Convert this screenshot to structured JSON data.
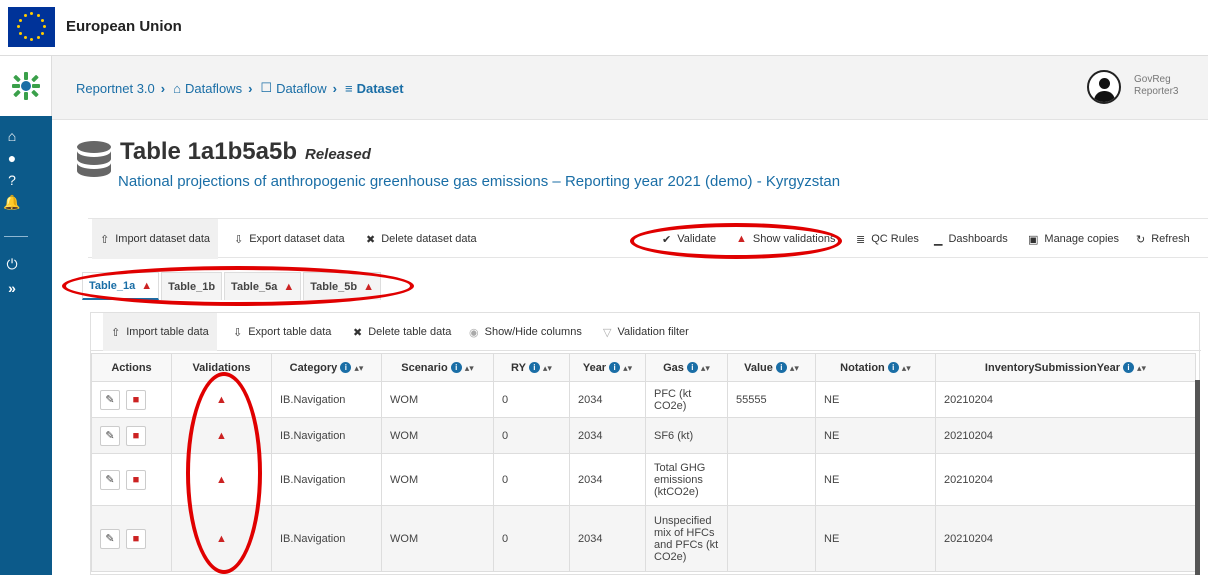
{
  "eu": {
    "title": "European Union"
  },
  "breadcrumb": {
    "items": [
      "Reportnet 3.0",
      "Dataflows",
      "Dataflow",
      "Dataset"
    ]
  },
  "user": {
    "line1": "GovReg",
    "line2": "Reporter3"
  },
  "page": {
    "title": "Table 1a1b5a5b",
    "status": "Released",
    "subtitle": "National projections of anthropogenic greenhouse gas emissions – Reporting year 2021 (demo) - Kyrgyzstan"
  },
  "dataset_toolbar": {
    "import": "Import dataset data",
    "export": "Export dataset data",
    "delete": "Delete dataset data",
    "validate": "Validate",
    "show_validations": "Show validations",
    "qc_rules": "QC Rules",
    "dashboards": "Dashboards",
    "manage_copies": "Manage copies",
    "refresh": "Refresh"
  },
  "tabs": [
    {
      "label": "Table_1a",
      "has_error": true
    },
    {
      "label": "Table_1b",
      "has_error": false
    },
    {
      "label": "Table_5a",
      "has_error": true
    },
    {
      "label": "Table_5b",
      "has_error": true
    }
  ],
  "table_toolbar": {
    "import": "Import table data",
    "export": "Export table data",
    "delete": "Delete table data",
    "show_hide": "Show/Hide columns",
    "validation_filter": "Validation filter"
  },
  "table": {
    "headers": [
      "Actions",
      "Validations",
      "Category",
      "Scenario",
      "RY",
      "Year",
      "Gas",
      "Value",
      "Notation",
      "InventorySubmissionYear"
    ],
    "rows": [
      {
        "category": "IB.Navigation",
        "scenario": "WOM",
        "ry": "0",
        "year": "2034",
        "gas": "PFC (kt CO2e)",
        "value": "55555",
        "notation": "NE",
        "isy": "20210204"
      },
      {
        "category": "IB.Navigation",
        "scenario": "WOM",
        "ry": "0",
        "year": "2034",
        "gas": "SF6 (kt)",
        "value": "",
        "notation": "NE",
        "isy": "20210204"
      },
      {
        "category": "IB.Navigation",
        "scenario": "WOM",
        "ry": "0",
        "year": "2034",
        "gas": "Total GHG emissions (ktCO2e)",
        "value": "",
        "notation": "NE",
        "isy": "20210204"
      },
      {
        "category": "IB.Navigation",
        "scenario": "WOM",
        "ry": "0",
        "year": "2034",
        "gas": "Unspecified mix of HFCs and PFCs (kt CO2e)",
        "value": "",
        "notation": "NE",
        "isy": "20210204"
      }
    ]
  },
  "colors": {
    "brand_blue": "#1a6ea6",
    "sidebar": "#0c5a8a",
    "error": "#cc2222",
    "annotation": "#e00000"
  }
}
